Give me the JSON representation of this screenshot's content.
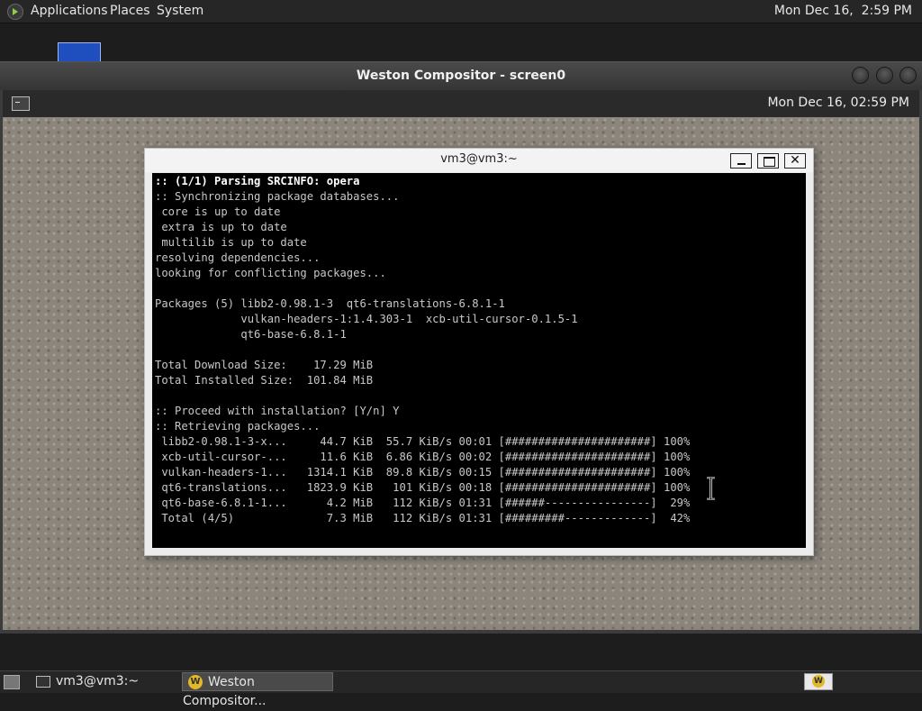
{
  "top_panel": {
    "menus": [
      "Applications",
      "Places",
      "System"
    ],
    "clock": "Mon Dec 16,  2:59 PM"
  },
  "weston": {
    "title": "Weston Compositor - screen0",
    "clock": "Mon Dec 16, 02:59 PM"
  },
  "terminal": {
    "title": "vm3@vm3:~",
    "min_label": "",
    "close_label": "✕",
    "header_bold": ":: (1/1) Parsing SRCINFO: opera",
    "lines": [
      ":: Synchronizing package databases...",
      " core is up to date",
      " extra is up to date",
      " multilib is up to date",
      "resolving dependencies...",
      "looking for conflicting packages...",
      "",
      "Packages (5) libb2-0.98.1-3  qt6-translations-6.8.1-1",
      "             vulkan-headers-1:1.4.303-1  xcb-util-cursor-0.1.5-1",
      "             qt6-base-6.8.1-1",
      "",
      "Total Download Size:    17.29 MiB",
      "Total Installed Size:  101.84 MiB",
      "",
      ":: Proceed with installation? [Y/n] Y",
      ":: Retrieving packages...",
      " libb2-0.98.1-3-x...     44.7 KiB  55.7 KiB/s 00:01 [######################] 100%",
      " xcb-util-cursor-...     11.6 KiB  6.86 KiB/s 00:02 [######################] 100%",
      " vulkan-headers-1...   1314.1 KiB  89.8 KiB/s 00:15 [######################] 100%",
      " qt6-translations...   1823.9 KiB   101 KiB/s 00:18 [######################] 100%",
      " qt6-base-6.8.1-1...      4.2 MiB   112 KiB/s 01:31 [######----------------]  29%",
      " Total (4/5)              7.3 MiB   112 KiB/s 01:31 [#########-------------]  42%"
    ]
  },
  "taskbar": {
    "items": [
      {
        "label": "vm3@vm3:~"
      },
      {
        "label": "Weston Compositor..."
      }
    ],
    "weston_icon_letter": "W"
  }
}
